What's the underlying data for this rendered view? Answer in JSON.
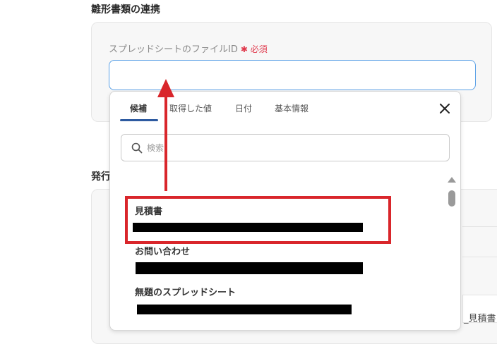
{
  "sections": {
    "first_title": "雛形書類の連携",
    "second_title": "発行"
  },
  "field": {
    "label": "スプレッドシートのファイルID",
    "required_mark": "✱",
    "required_text": "必須",
    "value": ""
  },
  "background_text": "_見積書",
  "dropdown": {
    "tabs": [
      {
        "label": "候補",
        "active": true
      },
      {
        "label": "取得した値",
        "active": false
      },
      {
        "label": "日付",
        "active": false
      },
      {
        "label": "基本情報",
        "active": false
      }
    ],
    "search": {
      "placeholder": "検索",
      "value": ""
    },
    "items": [
      {
        "label": "見積書",
        "highlighted": true
      },
      {
        "label": "お問い合わせ",
        "highlighted": false
      },
      {
        "label": "無題のスプレッドシート",
        "highlighted": false
      }
    ]
  },
  "colors": {
    "annotation_red": "#d9262b",
    "input_focus_border": "#5aa0e6",
    "tab_active_underline": "#2d5aa0",
    "required": "#e0394c"
  },
  "icons": {
    "close": "close-icon",
    "search": "search-icon",
    "scroll_up": "scroll-up-arrow-icon"
  }
}
